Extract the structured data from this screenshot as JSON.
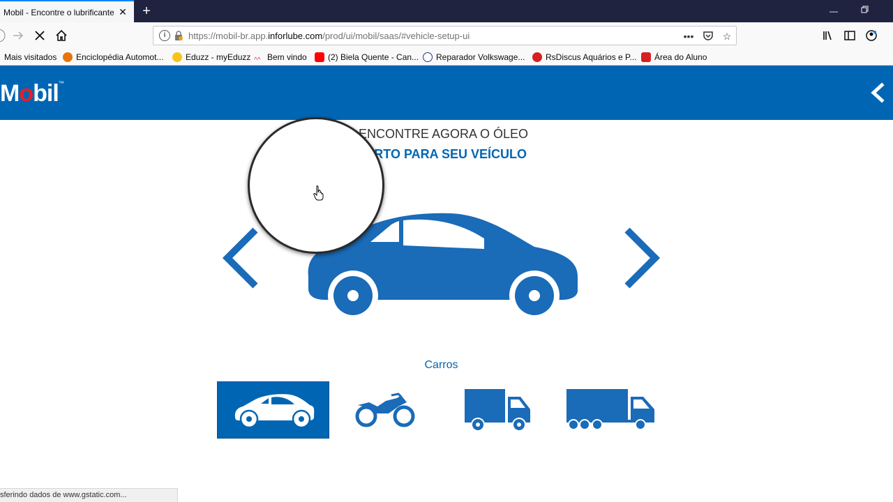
{
  "browser": {
    "tab_title": "Mobil - Encontre o lubrificante",
    "url_prefix": "https://mobil-br.app.",
    "url_host": "inforlube.com",
    "url_path": "/prod/ui/mobil/saas/#vehicle-setup-ui",
    "bookmarks": [
      {
        "label": "Mais visitados",
        "icon": "none"
      },
      {
        "label": "Enciclopédia Automot...",
        "icon": "orange-circle-icon"
      },
      {
        "label": "Eduzz - myEduzz",
        "icon": "yellow-e-icon"
      },
      {
        "label": "Bem vindo",
        "icon": "red-wave-icon"
      },
      {
        "label": "(2) Biela Quente - Can...",
        "icon": "youtube-icon"
      },
      {
        "label": "Reparador Volkswage...",
        "icon": "vw-logo-icon"
      },
      {
        "label": "RsDiscus Aquários e P...",
        "icon": "red-fish-icon"
      },
      {
        "label": "Área do Aluno",
        "icon": "red-grid-icon"
      }
    ],
    "status_text": "sferindo dados de www.gstatic.com..."
  },
  "header": {
    "logo_m": "M",
    "logo_o": "o",
    "logo_rest": "bil",
    "logo_tm": "™"
  },
  "content": {
    "headline_line1": "ENCONTRE AGORA O ÓLEO",
    "headline_line2": "RTO PARA SEU VEÍCULO",
    "category_label": "Carros",
    "vehicle_types": [
      {
        "icon": "car-icon",
        "active": true
      },
      {
        "icon": "motorcycle-icon",
        "active": false
      },
      {
        "icon": "van-truck-icon",
        "active": false
      },
      {
        "icon": "large-truck-icon",
        "active": false
      }
    ]
  },
  "colors": {
    "brand_blue": "#0066b3",
    "brand_red": "#ed1c24",
    "icon_blue": "#1a6bb8"
  }
}
